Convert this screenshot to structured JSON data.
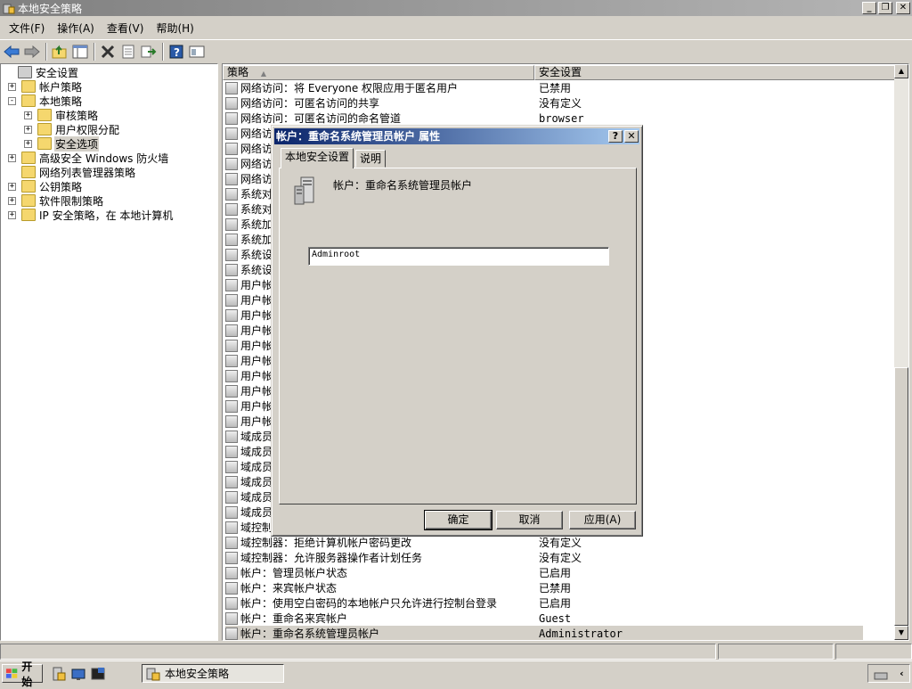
{
  "window": {
    "title": "本地安全策略",
    "buttons": [
      "_",
      "❐",
      "✕"
    ]
  },
  "menu": [
    "文件(F)",
    "操作(A)",
    "查看(V)",
    "帮助(H)"
  ],
  "toolbar_icons": [
    "back-icon",
    "forward-icon",
    "up-folder-icon",
    "show-tree-icon",
    "delete-icon",
    "properties-icon",
    "export-icon",
    "help-icon",
    "view-icon"
  ],
  "tree": [
    {
      "label": "安全设置",
      "level": 0,
      "exp": ""
    },
    {
      "label": "帐户策略",
      "level": 1,
      "exp": "+"
    },
    {
      "label": "本地策略",
      "level": 1,
      "exp": "-"
    },
    {
      "label": "审核策略",
      "level": 2,
      "exp": "+"
    },
    {
      "label": "用户权限分配",
      "level": 2,
      "exp": "+"
    },
    {
      "label": "安全选项",
      "level": 2,
      "exp": "+",
      "selected": true
    },
    {
      "label": "高级安全 Windows 防火墙",
      "level": 1,
      "exp": "+"
    },
    {
      "label": "网络列表管理器策略",
      "level": 1,
      "exp": ""
    },
    {
      "label": "公钥策略",
      "level": 1,
      "exp": "+"
    },
    {
      "label": "软件限制策略",
      "level": 1,
      "exp": "+"
    },
    {
      "label": "IP 安全策略，在 本地计算机",
      "level": 1,
      "exp": "+"
    }
  ],
  "list": {
    "columns": [
      "策略",
      "安全设置"
    ],
    "rows": [
      {
        "policy": "网络访问：将 Everyone 权限应用于匿名用户",
        "value": "已禁用"
      },
      {
        "policy": "网络访问：可匿名访问的共享",
        "value": "没有定义"
      },
      {
        "policy": "网络访问：可匿名访问的命名管道",
        "value": "browser"
      },
      {
        "policy": "网络访",
        "value": ""
      },
      {
        "policy": "网络访",
        "value": ""
      },
      {
        "policy": "网络访",
        "value": ""
      },
      {
        "policy": "网络访",
        "value": ""
      },
      {
        "policy": "系统对",
        "value": ""
      },
      {
        "policy": "系统对",
        "value": ""
      },
      {
        "policy": "系统加",
        "value": ""
      },
      {
        "policy": "系统加",
        "value": ""
      },
      {
        "policy": "系统设",
        "value": ""
      },
      {
        "policy": "系统设",
        "value": ""
      },
      {
        "policy": "用户帐",
        "value": ""
      },
      {
        "policy": "用户帐",
        "value": ""
      },
      {
        "policy": "用户帐",
        "value": ""
      },
      {
        "policy": "用户帐",
        "value": ""
      },
      {
        "policy": "用户帐",
        "value": ""
      },
      {
        "policy": "用户帐",
        "value": ""
      },
      {
        "policy": "用户帐",
        "value": ""
      },
      {
        "policy": "用户帐",
        "value": ""
      },
      {
        "policy": "用户帐",
        "value": ""
      },
      {
        "policy": "用户帐",
        "value": ""
      },
      {
        "policy": "域成员",
        "value": ""
      },
      {
        "policy": "域成员",
        "value": ""
      },
      {
        "policy": "域成员",
        "value": ""
      },
      {
        "policy": "域成员",
        "value": ""
      },
      {
        "policy": "域成员",
        "value": ""
      },
      {
        "policy": "域成员",
        "value": ""
      },
      {
        "policy": "域控制",
        "value": ""
      },
      {
        "policy": "域控制器：拒绝计算机帐户密码更改",
        "value": "没有定义"
      },
      {
        "policy": "域控制器：允许服务器操作者计划任务",
        "value": "没有定义"
      },
      {
        "policy": "帐户：管理员帐户状态",
        "value": "已启用"
      },
      {
        "policy": "帐户：来宾帐户状态",
        "value": "已禁用"
      },
      {
        "policy": "帐户：使用空白密码的本地帐户只允许进行控制台登录",
        "value": "已启用"
      },
      {
        "policy": "帐户：重命名来宾帐户",
        "value": "Guest"
      },
      {
        "policy": "帐户：重命名系统管理员帐户",
        "value": "Administrator",
        "selected": true
      }
    ]
  },
  "dialog": {
    "title": "帐户：重命名系统管理员帐户 属性",
    "tabs": [
      "本地安全设置",
      "说明"
    ],
    "policy_label": "帐户：重命名系统管理员帐户",
    "value": "Adminroot",
    "buttons": {
      "ok": "确定",
      "cancel": "取消",
      "apply": "应用(A)"
    },
    "title_buttons": [
      "?",
      "✕"
    ]
  },
  "taskbar": {
    "start": "开始",
    "task": "本地安全策略"
  },
  "colors": {
    "dialog_title_start": "#0a246a",
    "dialog_title_end": "#a6caf0",
    "window_title": "#808080"
  }
}
